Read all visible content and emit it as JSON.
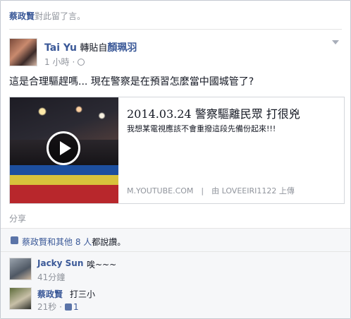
{
  "activity": {
    "actor": "蔡政賢",
    "text": "對此留了言。"
  },
  "post": {
    "author": "Tai Yu",
    "via_text": "轉貼自",
    "original_author": "顏珮羽",
    "time": "1 小時",
    "text": "這是合理驅趕嗎... 現在警察是在預習怎麼當中國城管了?"
  },
  "share": {
    "title": "2014.03.24 警察驅離民眾 打很兇",
    "description": "我想某電視應該不會重撥這段先備份起來!!!",
    "source": "M.YOUTUBE.COM　|　由 LOVEEIRI1122 上傳"
  },
  "actions": {
    "share_label": "分享"
  },
  "likes": {
    "text_prefix": "蔡政賢和其他",
    "count": "8 人",
    "text_suffix": "都說讚。"
  },
  "comments": [
    {
      "name": "Jacky Sun",
      "text": "唉~~~",
      "time": "41分鐘"
    },
    {
      "name": "蔡政賢",
      "text": "打三小",
      "time": "21秒",
      "likes": "1"
    }
  ],
  "icons": {
    "menu": "chevron-down-icon",
    "privacy": "globe-icon",
    "play": "play-icon",
    "like": "thumbs-up-icon"
  },
  "colors": {
    "link": "#3b5998",
    "meta": "#90949c"
  }
}
